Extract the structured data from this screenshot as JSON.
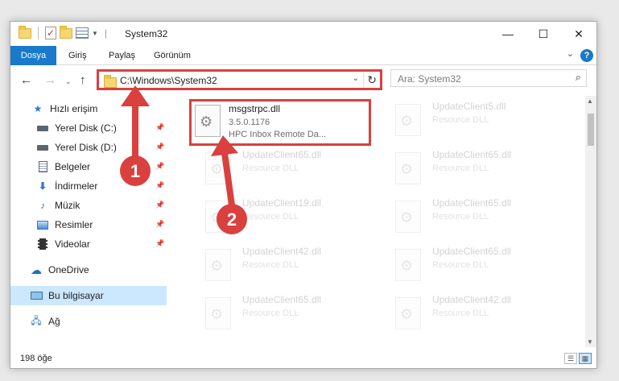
{
  "window": {
    "title": "System32",
    "controls": {
      "minimize": "—",
      "maximize": "☐",
      "close": "✕"
    }
  },
  "ribbon": {
    "tabs": [
      "Dosya",
      "Giriş",
      "Paylaş",
      "Görünüm"
    ],
    "help": "?"
  },
  "navigation": {
    "address_path": "C:\\Windows\\System32",
    "search_placeholder": "Ara: System32"
  },
  "sidebar": {
    "items": [
      {
        "label": "Hızlı erişim",
        "icon": "star-icon",
        "pinned": false
      },
      {
        "label": "Yerel Disk (C:)",
        "icon": "drive-icon",
        "pinned": true
      },
      {
        "label": "Yerel Disk (D:)",
        "icon": "drive-icon",
        "pinned": true
      },
      {
        "label": "Belgeler",
        "icon": "document-icon",
        "pinned": true
      },
      {
        "label": "İndirmeler",
        "icon": "download-icon",
        "pinned": true
      },
      {
        "label": "Müzik",
        "icon": "music-icon",
        "pinned": true
      },
      {
        "label": "Resimler",
        "icon": "pictures-icon",
        "pinned": true
      },
      {
        "label": "Videolar",
        "icon": "video-icon",
        "pinned": true
      },
      {
        "label": "OneDrive",
        "icon": "cloud-icon",
        "pinned": false
      },
      {
        "label": "Bu bilgisayar",
        "icon": "computer-icon",
        "pinned": false,
        "selected": true
      },
      {
        "label": "Ağ",
        "icon": "network-icon",
        "pinned": false
      }
    ]
  },
  "files": [
    {
      "name": "msgstrpc.dll",
      "version": "3.5.0.1176",
      "description": "HPC Inbox Remote Da...",
      "highlighted": true
    },
    {
      "name": "UpdateClient5.dll",
      "description": "Resource DLL"
    },
    {
      "name": "UpdateClient65.dll",
      "description": "Resource DLL"
    },
    {
      "name": "UpdateClient65.dll",
      "description": "Resource DLL"
    },
    {
      "name": "UpdateClient19.dll",
      "description": "Resource DLL"
    },
    {
      "name": "UpdateClient65.dll",
      "description": "Resource DLL"
    },
    {
      "name": "UpdateClient42.dll",
      "description": "Resource DLL"
    },
    {
      "name": "UpdateClient65.dll",
      "description": "Resource DLL"
    },
    {
      "name": "UpdateClient65.dll",
      "description": "Resource DLL"
    },
    {
      "name": "UpdateClient42.dll",
      "description": "Resource DLL"
    }
  ],
  "status": {
    "item_count": "198 öğe"
  },
  "annotations": [
    {
      "number": "1"
    },
    {
      "number": "2"
    }
  ],
  "colors": {
    "accent": "#1979ca",
    "highlight": "#d9403e",
    "selection": "#cce8ff"
  }
}
